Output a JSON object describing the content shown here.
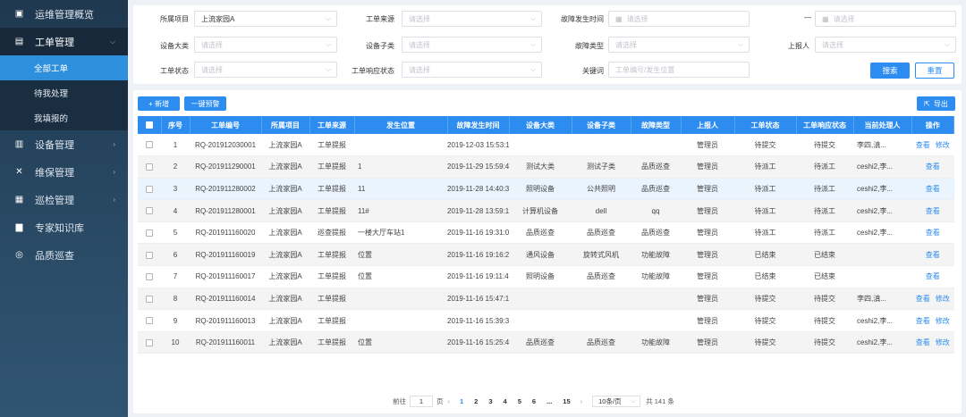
{
  "sidebar": {
    "items": [
      {
        "label": "运维管理概览",
        "icon": "clipboard-icon",
        "glyph": "▣"
      },
      {
        "label": "工单管理",
        "icon": "briefcase-icon",
        "glyph": "▤"
      },
      {
        "label": "设备管理",
        "icon": "equipment-icon",
        "glyph": "▥"
      },
      {
        "label": "维保管理",
        "icon": "wrench-icon",
        "glyph": "✕"
      },
      {
        "label": "巡检管理",
        "icon": "inspection-icon",
        "glyph": "▦"
      },
      {
        "label": "专家知识库",
        "icon": "book-icon",
        "glyph": "▆"
      },
      {
        "label": "品质巡查",
        "icon": "quality-icon",
        "glyph": "◎"
      }
    ],
    "sub_items": [
      "全部工单",
      "待我处理",
      "我填报的"
    ]
  },
  "filters": {
    "project_label": "所属项目",
    "project_value": "上流家园A",
    "source_label": "工单来源",
    "source_ph": "请选择",
    "fault_time_label": "故障发生时间",
    "fault_time_start_ph": "请选择",
    "range_sep": "—",
    "fault_time_end_ph": "请选择",
    "category_label": "设备大类",
    "category_ph": "请选择",
    "subcategory_label": "设备子类",
    "subcategory_ph": "请选择",
    "fault_type_label": "故障类型",
    "fault_type_ph": "请选择",
    "reporter_label": "上报人",
    "reporter_ph": "请选择",
    "status_label": "工单状态",
    "status_ph": "请选择",
    "resp_status_label": "工单响应状态",
    "resp_status_ph": "请选择",
    "keyword_label": "关键词",
    "keyword_ph": "工单编号/发生位置",
    "search_label": "搜索",
    "reset_label": "重置"
  },
  "toolbar": {
    "add_label": "+ 新增",
    "remind_label": "一键预警",
    "export_label": "导出"
  },
  "table": {
    "headers": [
      "序号",
      "工单编号",
      "所属项目",
      "工单来源",
      "发生位置",
      "故障发生时间",
      "设备大类",
      "设备子类",
      "故障类型",
      "上报人",
      "工单状态",
      "工单响应状态",
      "当前处理人",
      "操作"
    ],
    "op_view": "查看",
    "op_edit": "修改",
    "rows": [
      {
        "no": "1",
        "code": "RQ-201912030001",
        "project": "上流家园A",
        "source": "工单提报",
        "loc": "",
        "time": "2019-12-03 15:53:10",
        "cat": "",
        "sub": "",
        "ftype": "",
        "reporter": "管理员",
        "status": "待提交",
        "resp": "待提交",
        "handler": "李四,滇...",
        "edit": true
      },
      {
        "no": "2",
        "code": "RQ-201911290001",
        "project": "上流家园A",
        "source": "工单提报",
        "loc": "1",
        "time": "2019-11-29 15:59:43",
        "cat": "测试大类",
        "sub": "测试子类",
        "ftype": "品质巡查",
        "reporter": "管理员",
        "status": "待派工",
        "resp": "待派工",
        "handler": "ceshi2,李...",
        "edit": false
      },
      {
        "no": "3",
        "code": "RQ-201911280002",
        "project": "上流家园A",
        "source": "工单提报",
        "loc": "11",
        "time": "2019-11-28 14:40:36",
        "cat": "照明设备",
        "sub": "公共照明",
        "ftype": "品质巡查",
        "reporter": "管理员",
        "status": "待派工",
        "resp": "待派工",
        "handler": "ceshi2,李...",
        "edit": false
      },
      {
        "no": "4",
        "code": "RQ-201911280001",
        "project": "上流家园A",
        "source": "工单提报",
        "loc": "11#",
        "time": "2019-11-28 13:59:18",
        "cat": "计算机设备",
        "sub": "dell",
        "ftype": "qq",
        "reporter": "管理员",
        "status": "待派工",
        "resp": "待派工",
        "handler": "ceshi2,李...",
        "edit": false
      },
      {
        "no": "5",
        "code": "RQ-201911160020",
        "project": "上流家园A",
        "source": "巡查提报",
        "loc": "一楼大厅车站1",
        "time": "2019-11-16 19:31:00",
        "cat": "品质巡查",
        "sub": "品质巡查",
        "ftype": "品质巡查",
        "reporter": "管理员",
        "status": "待派工",
        "resp": "待派工",
        "handler": "ceshi2,李...",
        "edit": false
      },
      {
        "no": "6",
        "code": "RQ-201911160019",
        "project": "上流家园A",
        "source": "工单提报",
        "loc": "位置",
        "time": "2019-11-16 19:16:24",
        "cat": "通风设备",
        "sub": "旋转式风机",
        "ftype": "功能故障",
        "reporter": "管理员",
        "status": "已结束",
        "resp": "已结束",
        "handler": "",
        "edit": false
      },
      {
        "no": "7",
        "code": "RQ-201911160017",
        "project": "上流家园A",
        "source": "工单提报",
        "loc": "位置",
        "time": "2019-11-16 19:11:40",
        "cat": "照明设备",
        "sub": "品质巡查",
        "ftype": "功能故障",
        "reporter": "管理员",
        "status": "已结束",
        "resp": "已结束",
        "handler": "",
        "edit": false
      },
      {
        "no": "8",
        "code": "RQ-201911160014",
        "project": "上流家园A",
        "source": "工单提报",
        "loc": "",
        "time": "2019-11-16 15:47:18",
        "cat": "",
        "sub": "",
        "ftype": "",
        "reporter": "管理员",
        "status": "待提交",
        "resp": "待提交",
        "handler": "李四,滇...",
        "edit": true
      },
      {
        "no": "9",
        "code": "RQ-201911160013",
        "project": "上流家园A",
        "source": "工单提报",
        "loc": "",
        "time": "2019-11-16 15:39:30",
        "cat": "",
        "sub": "",
        "ftype": "",
        "reporter": "管理员",
        "status": "待提交",
        "resp": "待提交",
        "handler": "ceshi2,李...",
        "edit": true
      },
      {
        "no": "10",
        "code": "RQ-201911160011",
        "project": "上流家园A",
        "source": "工单提报",
        "loc": "位置",
        "time": "2019-11-16 15:25:40",
        "cat": "品质巡查",
        "sub": "品质巡查",
        "ftype": "功能故障",
        "reporter": "管理员",
        "status": "待提交",
        "resp": "待提交",
        "handler": "ceshi2,李...",
        "edit": true
      }
    ]
  },
  "pager": {
    "goto_prefix": "前往",
    "goto_value": "1",
    "goto_suffix": "页",
    "pages": [
      "1",
      "2",
      "3",
      "4",
      "5",
      "6",
      "...",
      "15"
    ],
    "current": "1",
    "size_label": "10条/页",
    "total_label": "共 141 条"
  },
  "colors": {
    "primary": "#2d8cf0",
    "sidebar": "#1f3850",
    "active_sub": "#2e8fdc"
  }
}
